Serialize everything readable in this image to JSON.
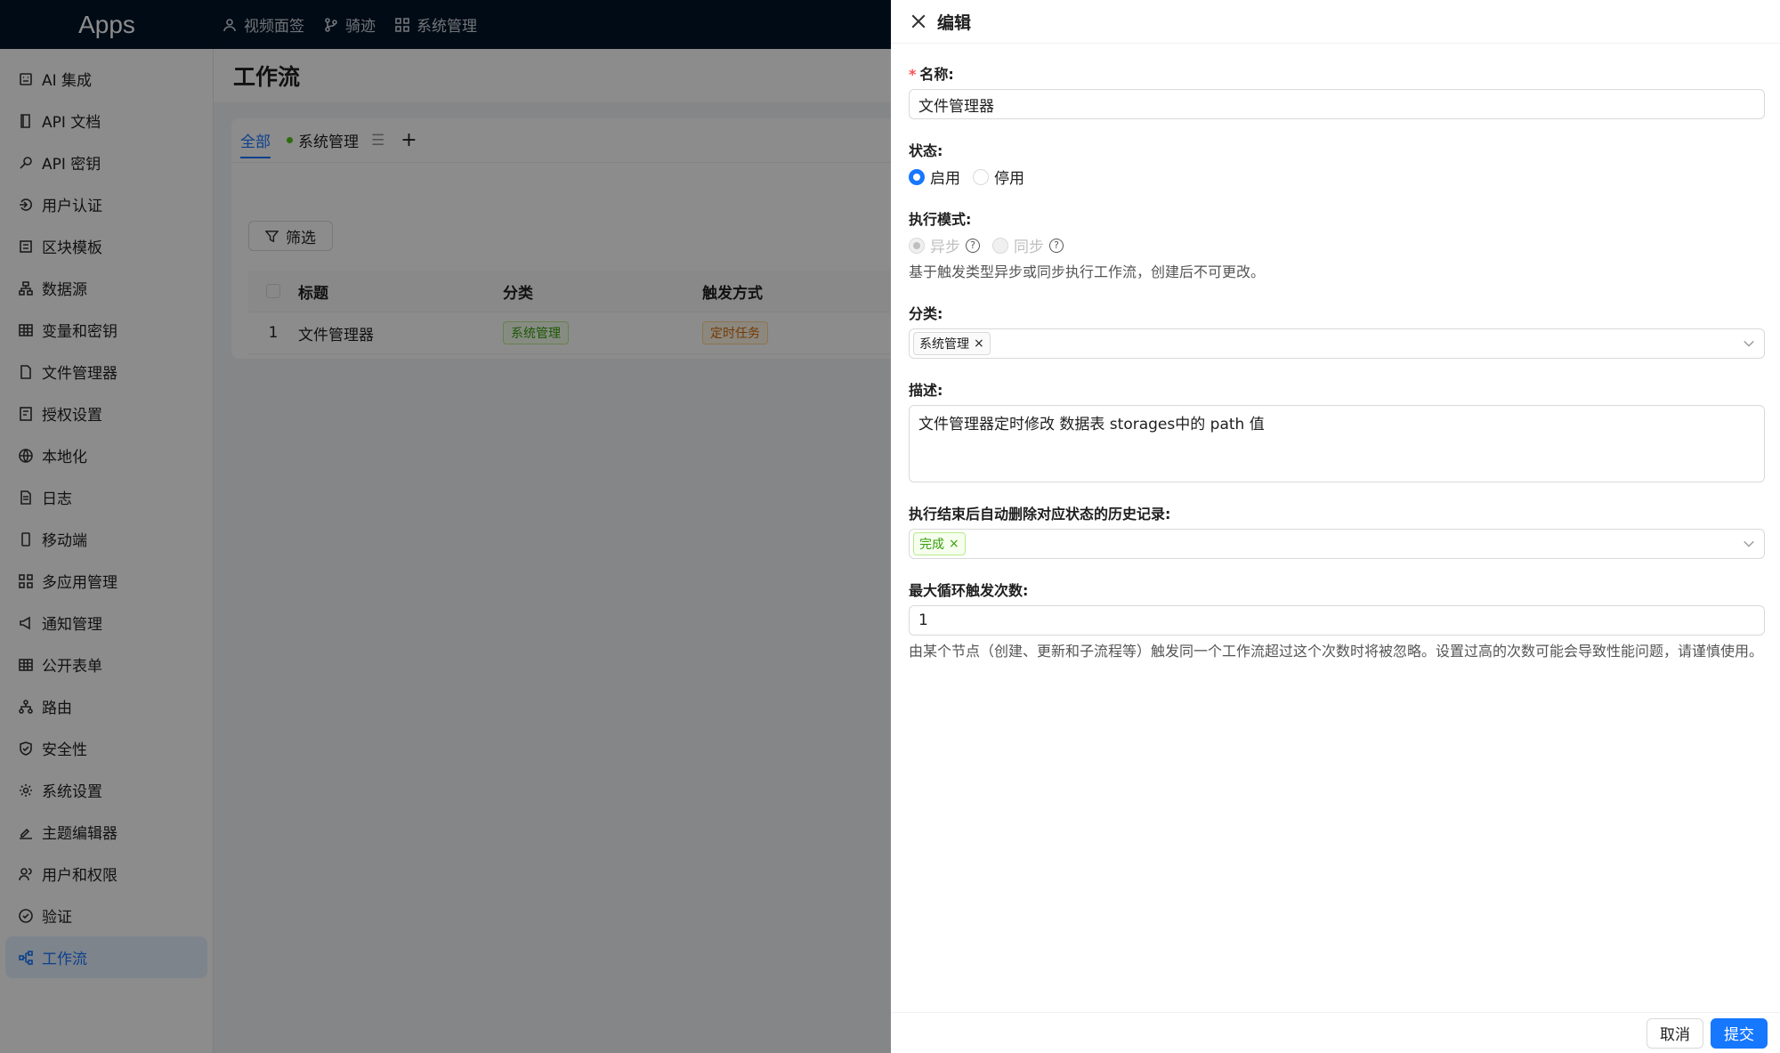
{
  "app": {
    "logo": "Apps"
  },
  "topnav": [
    {
      "label": "视频面签",
      "icon": "user-icon"
    },
    {
      "label": "骑迹",
      "icon": "branch-icon"
    },
    {
      "label": "系统管理",
      "icon": "grid-icon"
    }
  ],
  "sidebar": {
    "items": [
      {
        "label": "AI 集成",
        "icon": "robot-icon"
      },
      {
        "label": "API 文档",
        "icon": "book-icon"
      },
      {
        "label": "API 密钥",
        "icon": "key-icon"
      },
      {
        "label": "用户认证",
        "icon": "login-icon"
      },
      {
        "label": "区块模板",
        "icon": "layout-icon"
      },
      {
        "label": "数据源",
        "icon": "database-icon"
      },
      {
        "label": "变量和密钥",
        "icon": "table-icon"
      },
      {
        "label": "文件管理器",
        "icon": "file-icon"
      },
      {
        "label": "授权设置",
        "icon": "license-icon"
      },
      {
        "label": "本地化",
        "icon": "globe-icon"
      },
      {
        "label": "日志",
        "icon": "log-icon"
      },
      {
        "label": "移动端",
        "icon": "mobile-icon"
      },
      {
        "label": "多应用管理",
        "icon": "apps-icon"
      },
      {
        "label": "通知管理",
        "icon": "notification-icon"
      },
      {
        "label": "公开表单",
        "icon": "form-icon"
      },
      {
        "label": "路由",
        "icon": "route-icon"
      },
      {
        "label": "安全性",
        "icon": "shield-icon"
      },
      {
        "label": "系统设置",
        "icon": "gear-icon"
      },
      {
        "label": "主题编辑器",
        "icon": "theme-icon"
      },
      {
        "label": "用户和权限",
        "icon": "users-icon"
      },
      {
        "label": "验证",
        "icon": "check-circle-icon"
      },
      {
        "label": "工作流",
        "icon": "workflow-icon"
      }
    ]
  },
  "page": {
    "title": "工作流",
    "tabs": [
      {
        "label": "全部"
      },
      {
        "label": "系统管理"
      }
    ],
    "filter_label": "筛选",
    "table": {
      "headers": [
        "标题",
        "分类",
        "触发方式"
      ],
      "rows": [
        {
          "index": "1",
          "title": "文件管理器",
          "category": "系统管理",
          "trigger": "定时任务"
        }
      ]
    }
  },
  "drawer": {
    "title": "编辑",
    "name_label": "名称:",
    "name_value": "文件管理器",
    "status_label": "状态:",
    "status_options": [
      "启用",
      "停用"
    ],
    "mode_label": "执行模式:",
    "mode_options": [
      "异步",
      "同步"
    ],
    "mode_help": "基于触发类型异步或同步执行工作流，创建后不可更改。",
    "category_label": "分类:",
    "category_value": "系统管理",
    "desc_label": "描述:",
    "desc_value": "文件管理器定时修改 数据表 storages中的 path 值",
    "auto_delete_label": "执行结束后自动删除对应状态的历史记录:",
    "auto_delete_value": "完成",
    "max_loop_label": "最大循环触发次数:",
    "max_loop_value": "1",
    "max_loop_help": "由某个节点（创建、更新和子流程等）触发同一个工作流超过这个次数时将被忽略。设置过高的次数可能会导致性能问题，请谨慎使用。",
    "cancel_label": "取消",
    "submit_label": "提交"
  },
  "colors": {
    "primary": "#1677ff",
    "header_bg": "#001529",
    "overlay": "rgba(0,0,0,0.45)"
  }
}
